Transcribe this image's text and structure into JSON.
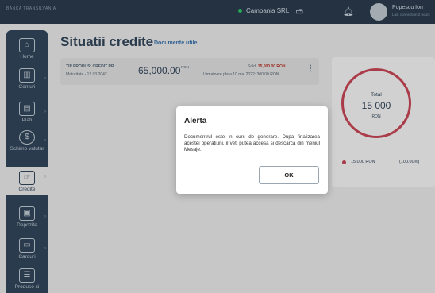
{
  "header": {
    "logo_text": "BANCA TRANSILVANIA",
    "company": "Campania SRL",
    "user_name": "Popescu Ion",
    "user_sub": "Last connection 2 hours"
  },
  "sidebar": {
    "items": [
      {
        "label": "Home",
        "icon": "home-icon"
      },
      {
        "label": "Conturi",
        "icon": "bank-icon"
      },
      {
        "label": "Plati",
        "icon": "payments-icon"
      },
      {
        "label": "Schimb valutar",
        "icon": "currency-exchange-icon"
      },
      {
        "label": "Credite",
        "icon": "credit-icon"
      },
      {
        "label": "Depozite",
        "icon": "deposit-icon"
      },
      {
        "label": "Carduri",
        "icon": "card-icon"
      },
      {
        "label": "Produse si",
        "icon": "products-icon"
      }
    ]
  },
  "main": {
    "title": "Situatii credite",
    "docs_link": "Documente utile"
  },
  "credit": {
    "type": "TIP PRODUS: CREDIT PR...",
    "maturity": "Maturitate - 12.03.2042",
    "amount": "65,000.00",
    "currency": "RON",
    "sold_label": "Sold:",
    "sold_value": "15,000.00 RON",
    "next_payment": "Urmatoare plata 10 mai 2022: 300.00 RON"
  },
  "summary": {
    "total_label": "Total",
    "total_value": "15 000",
    "total_currency": "RON",
    "legend_value": "15.000 RON",
    "legend_pct": "(100.00%)",
    "ring_color": "#d04a5a"
  },
  "dialog": {
    "title": "Alerta",
    "message": "Documentrul este in curs de generare. Dupa finalizarea acestei operatiuni, il veti putea accesa si descarca din meniul Mesaje.",
    "ok_label": "OK"
  }
}
